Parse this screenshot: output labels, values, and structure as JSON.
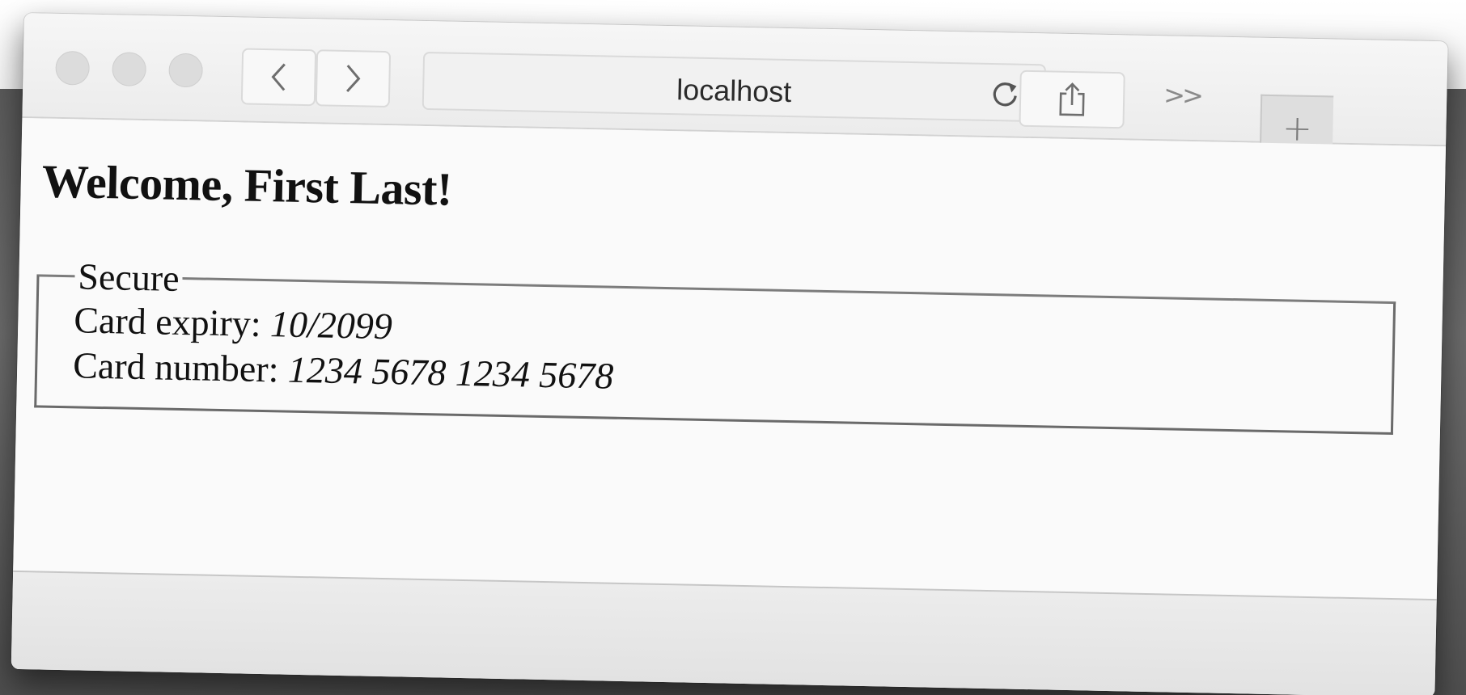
{
  "browser": {
    "address": "localhost",
    "overflow_label": ">>",
    "new_tab_label": "+"
  },
  "page": {
    "heading": "Welcome, First Last!",
    "fieldset_legend": "Secure",
    "card_expiry_label": "Card expiry: ",
    "card_expiry_value": "10/2099",
    "card_number_label": "Card number: ",
    "card_number_value": "1234 5678 1234 5678"
  },
  "icons": {
    "traffic_lights": [
      "close-icon",
      "minimize-icon",
      "zoom-icon"
    ],
    "back": "chevron-left-icon",
    "forward": "chevron-right-icon",
    "reload": "reload-icon",
    "share": "share-icon",
    "overflow": "double-chevron-icon",
    "new_tab": "plus-icon"
  },
  "colors": {
    "backdrop": "#5a5a5a",
    "toolbar": "#ececec",
    "page_background": "#fafafa",
    "traffic_light_inactive": "#dcdcdc"
  }
}
